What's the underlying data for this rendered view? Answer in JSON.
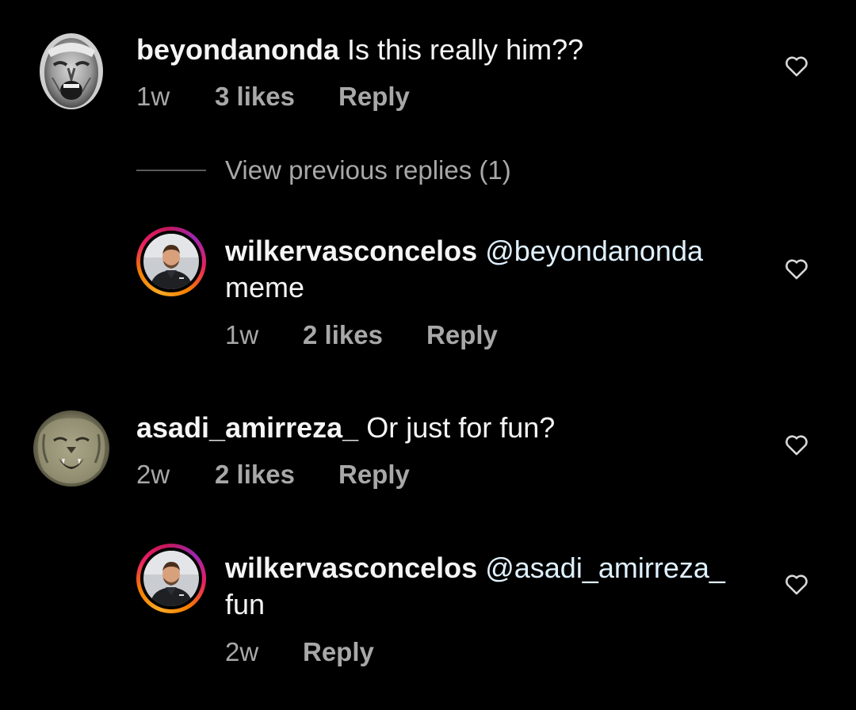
{
  "comments": [
    {
      "username": "beyondanonda",
      "text": "Is this really him??",
      "time": "1w",
      "likes": "3 likes",
      "reply": "Reply",
      "avatar": "man-screaming-bw",
      "liked": false
    },
    {
      "username": "asadi_amirreza_",
      "text": "Or just for fun?",
      "time": "2w",
      "likes": "2 likes",
      "reply": "Reply",
      "avatar": "lion-roaring",
      "liked": false
    }
  ],
  "view_previous_replies": "View previous replies (1)",
  "replies": [
    {
      "username": "wilkervasconcelos",
      "mention": "@beyondanonda",
      "text": "meme",
      "time": "1w",
      "likes": "2 likes",
      "reply": "Reply",
      "avatar": "man-portrait-story-ring",
      "liked": false
    },
    {
      "username": "wilkervasconcelos",
      "mention": "@asadi_amirreza_",
      "text": "fun",
      "time": "2w",
      "reply": "Reply",
      "avatar": "man-portrait-story-ring",
      "liked": false
    }
  ],
  "colors": {
    "background": "#000000",
    "primary_text": "#f5f5f5",
    "secondary_text": "#a8a8a8",
    "mention": "#e0f1ff",
    "story_ring_start": "#f9a825",
    "story_ring_end": "#c2185b"
  },
  "icons": {
    "like": "heart-outline-icon"
  }
}
